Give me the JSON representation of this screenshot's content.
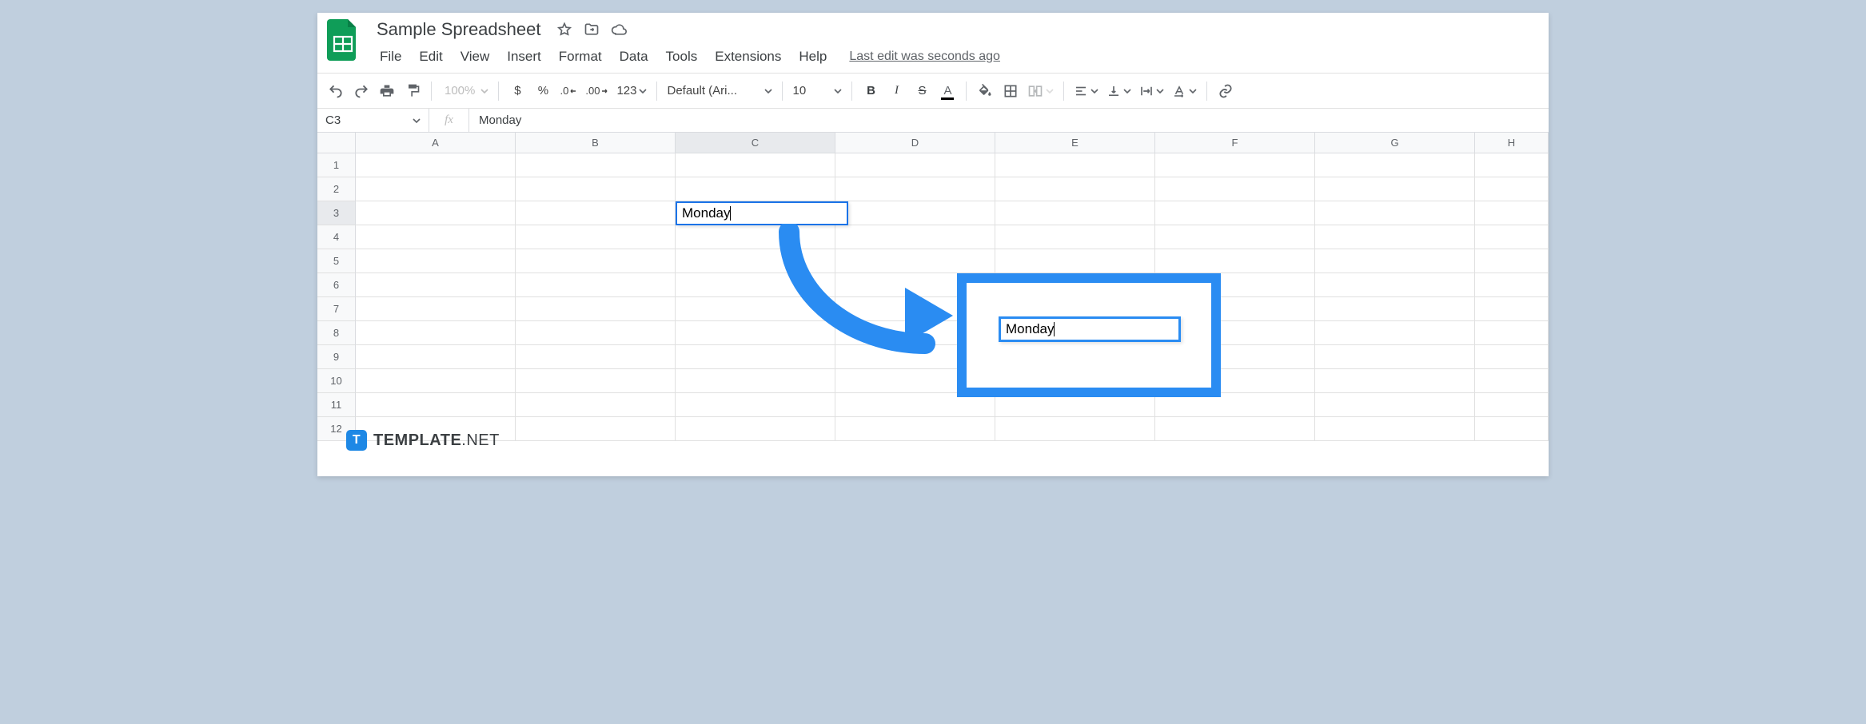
{
  "doc": {
    "title": "Sample Spreadsheet",
    "last_edit": "Last edit was seconds ago"
  },
  "menu": {
    "file": "File",
    "edit": "Edit",
    "view": "View",
    "insert": "Insert",
    "format": "Format",
    "data": "Data",
    "tools": "Tools",
    "extensions": "Extensions",
    "help": "Help"
  },
  "toolbar": {
    "zoom": "100%",
    "currency": "$",
    "percent": "%",
    "dec_dec": ".0",
    "inc_dec": ".00",
    "numfmt": "123",
    "font": "Default (Ari...",
    "size": "10",
    "bold": "B",
    "italic": "I",
    "strike": "S",
    "textcolor": "A"
  },
  "fxbar": {
    "cellref": "C3",
    "fx": "fx",
    "formula": "Monday"
  },
  "grid": {
    "cols": [
      "A",
      "B",
      "C",
      "D",
      "E",
      "F",
      "G",
      "H"
    ],
    "rows": [
      "1",
      "2",
      "3",
      "4",
      "5",
      "6",
      "7",
      "8",
      "9",
      "10",
      "11",
      "12"
    ],
    "editing_value": "Monday",
    "callout_value": "Monday"
  },
  "watermark": {
    "badge": "T",
    "brand": "TEMPLATE",
    "suffix": ".NET"
  }
}
